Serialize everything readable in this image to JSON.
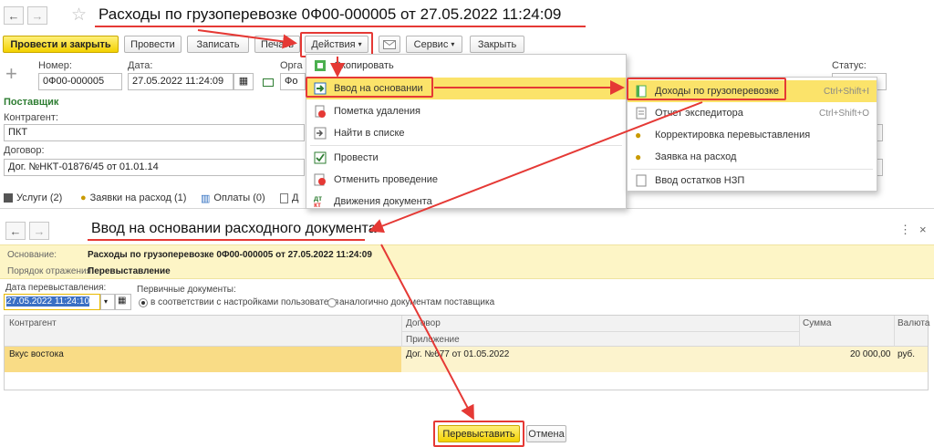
{
  "doc": {
    "title": "Расходы по грузоперевозке  0Ф00-000005 от 27.05.2022 11:24:09",
    "toolbar": {
      "post_close": "Провести и закрыть",
      "post": "Провести",
      "write": "Записать",
      "print": "Печать",
      "actions": "Действия",
      "service": "Сервис",
      "close": "Закрыть"
    },
    "number_label": "Номер:",
    "number_value": "0Ф00-000005",
    "date_label": "Дата:",
    "date_value": "27.05.2022 11:24:09",
    "org_label": "Орга",
    "org_value": "Фо",
    "status_label": "Статус:",
    "section_supplier": "Поставщик",
    "counterparty_label": "Контрагент:",
    "counterparty_value": "ПКТ",
    "contract_label": "Договор:",
    "contract_value": "Дог. №НКТ-01876/45 от 01.01.14",
    "tabs": {
      "services": "Услуги (2)",
      "requests": "Заявки на расход (1)",
      "payments": "Оплаты (0)",
      "more": "Д"
    }
  },
  "actions_menu": {
    "items": [
      {
        "label": "Скопировать",
        "icon": "copy-icon"
      },
      {
        "label": "Ввод на основании",
        "icon": "create-based-on-icon"
      },
      {
        "label": "Пометка удаления",
        "icon": "delete-mark-icon"
      },
      {
        "label": "Найти в списке",
        "icon": "find-in-list-icon"
      },
      {
        "label": "Провести",
        "icon": "post-icon"
      },
      {
        "label": "Отменить проведение",
        "icon": "cancel-posting-icon"
      },
      {
        "label": "Движения документа",
        "icon": "dt-kt-icon"
      }
    ]
  },
  "submenu": {
    "items": [
      {
        "label": "Доходы по грузоперевозке",
        "shortcut": "Ctrl+Shift+I"
      },
      {
        "label": "Отчет экспедитора",
        "shortcut": "Ctrl+Shift+O"
      },
      {
        "label": "Корректировка перевыставления",
        "shortcut": ""
      },
      {
        "label": "Заявка на расход",
        "shortcut": ""
      },
      {
        "label": "Ввод остатков НЗП",
        "shortcut": ""
      }
    ]
  },
  "dialog": {
    "title": "Ввод на основании расходного документа",
    "basis_label": "Основание:",
    "basis_value": "Расходы по грузоперевозке 0Ф00-000005 от 27.05.2022 11:24:09",
    "order_label": "Порядок отражения:",
    "order_value": "Перевыставление",
    "rebill_date_label": "Дата перевыставления:",
    "rebill_date_value": "27.05.2022 11:24:10",
    "primary_docs_label": "Первичные документы:",
    "radio_user": "в соответствии с настройками пользователя",
    "radio_supplier": "аналогично документам поставщика",
    "columns": {
      "counterparty": "Контрагент",
      "contract": "Договор",
      "attachment": "Приложение",
      "amount": "Сумма",
      "currency": "Валюта"
    },
    "rows": [
      {
        "counterparty": "Вкус востока",
        "contract": "Дог. №677 от 01.05.2022",
        "amount": "20 000,00",
        "currency": "руб."
      }
    ],
    "rebill_button": "Перевыставить",
    "cancel_button": "Отмена"
  },
  "colors": {
    "accent_yellow": "#f3d100",
    "highlight": "#fbe36a",
    "annotation_red": "#e53935",
    "info_panel": "#fdf5c6",
    "section_green": "#2e7d32"
  }
}
